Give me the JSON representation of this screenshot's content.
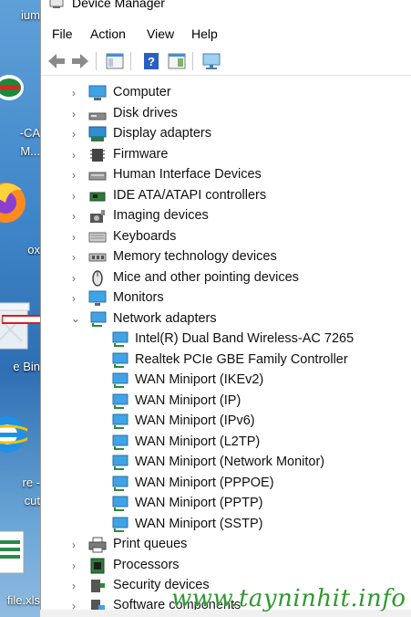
{
  "desktop": {
    "labels": [
      "ium",
      "-CA",
      "M...",
      "ox",
      "e Bin",
      "re -",
      "cut",
      "file.xls"
    ]
  },
  "window": {
    "title": "Device Manager",
    "icon": "device-manager-icon"
  },
  "menu": [
    "File",
    "Action",
    "View",
    "Help"
  ],
  "toolbar": {
    "buttons": [
      "back-arrow-icon",
      "forward-arrow-icon",
      "show-hide-console-tree-icon",
      "help-icon",
      "properties-pane-icon",
      "scan-hardware-monitor-icon"
    ]
  },
  "tree": {
    "categories_before": [
      {
        "label": "Computer",
        "icon": "computer-icon"
      },
      {
        "label": "Disk drives",
        "icon": "disk-drive-icon"
      },
      {
        "label": "Display adapters",
        "icon": "display-adapter-icon"
      },
      {
        "label": "Firmware",
        "icon": "firmware-chip-icon"
      },
      {
        "label": "Human Interface Devices",
        "icon": "hid-icon"
      },
      {
        "label": "IDE ATA/ATAPI controllers",
        "icon": "ide-controller-icon"
      },
      {
        "label": "Imaging devices",
        "icon": "camera-icon"
      },
      {
        "label": "Keyboards",
        "icon": "keyboard-icon"
      },
      {
        "label": "Memory technology devices",
        "icon": "memory-device-icon"
      },
      {
        "label": "Mice and other pointing devices",
        "icon": "mouse-icon"
      },
      {
        "label": "Monitors",
        "icon": "monitor-icon"
      }
    ],
    "expanded": {
      "label": "Network adapters",
      "icon": "network-adapter-icon"
    },
    "network_children": [
      "Intel(R) Dual Band Wireless-AC 7265",
      "Realtek PCIe GBE Family Controller",
      "WAN Miniport (IKEv2)",
      "WAN Miniport (IP)",
      "WAN Miniport (IPv6)",
      "WAN Miniport (L2TP)",
      "WAN Miniport (Network Monitor)",
      "WAN Miniport (PPPOE)",
      "WAN Miniport (PPTP)",
      "WAN Miniport (SSTP)"
    ],
    "categories_after": [
      {
        "label": "Print queues",
        "icon": "printer-icon"
      },
      {
        "label": "Processors",
        "icon": "processor-icon"
      },
      {
        "label": "Security devices",
        "icon": "security-device-icon"
      },
      {
        "label": "Software components",
        "icon": "software-component-icon"
      }
    ]
  },
  "watermark": "www.tayninhit.info",
  "colors": {
    "accent": "#3b8fd6",
    "annotation_arrow": "#d81e1e",
    "watermark": "#2f9a2f"
  }
}
